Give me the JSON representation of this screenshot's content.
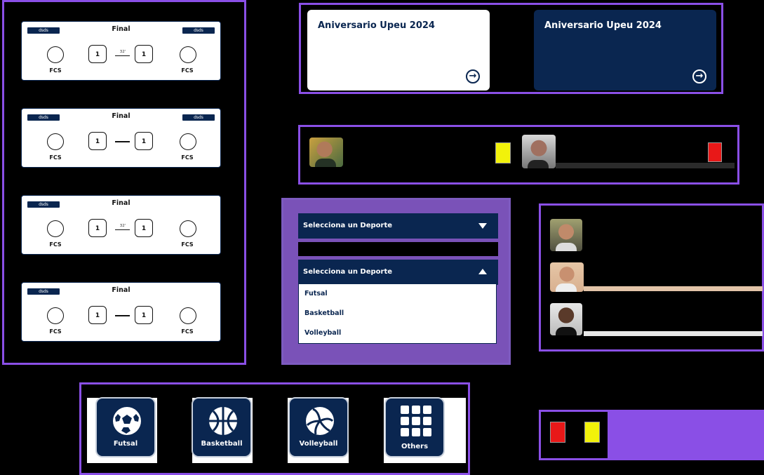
{
  "matches": [
    {
      "title": "Final",
      "tag_left": "dsds",
      "tag_right": "dsds",
      "home": "FCS",
      "away": "FCS",
      "home_score": "1",
      "away_score": "1",
      "minute": "32'"
    },
    {
      "title": "Final",
      "tag_left": "dsds",
      "tag_right": "dsds",
      "home": "FCS",
      "away": "FCS",
      "home_score": "1",
      "away_score": "1",
      "minute": ""
    },
    {
      "title": "Final",
      "tag_left": "dsds",
      "tag_right": "",
      "home": "FCS",
      "away": "FCS",
      "home_score": "1",
      "away_score": "1",
      "minute": "32'"
    },
    {
      "title": "Final",
      "tag_left": "dsds",
      "tag_right": "",
      "home": "FCS",
      "away": "FCS",
      "home_score": "1",
      "away_score": "1",
      "minute": ""
    }
  ],
  "events": [
    {
      "title": "Aniversario Upeu 2024",
      "theme": "light"
    },
    {
      "title": "Aniversario Upeu 2024",
      "theme": "dark"
    }
  ],
  "select": {
    "placeholder": "Selecciona un Deporte",
    "options": [
      "Futsal",
      "Basketball",
      "Volleyball"
    ]
  },
  "sports": [
    {
      "label": "Futsal",
      "icon": "soccer-ball-icon"
    },
    {
      "label": "Basketball",
      "icon": "basketball-icon"
    },
    {
      "label": "Volleyball",
      "icon": "volleyball-icon"
    },
    {
      "label": "Others",
      "icon": "grid-icon"
    }
  ],
  "colors": {
    "navy": "#0a2650",
    "accent": "#8a4fe6",
    "yellow_card": "#f2f20a",
    "red_card": "#e81818"
  }
}
